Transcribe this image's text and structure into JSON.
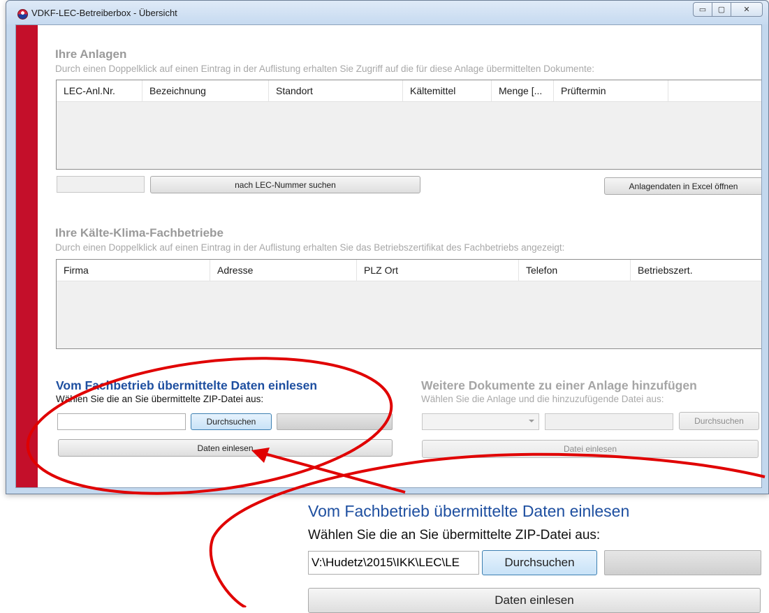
{
  "window": {
    "title": "VDKF-LEC-Betreiberbox - Übersicht",
    "controls": {
      "minimize": "▭",
      "maximize": "▢",
      "close": "✕"
    }
  },
  "anlagen": {
    "title": "Ihre Anlagen",
    "description": "Durch einen Doppelklick auf einen Eintrag in der Auflistung erhalten Sie Zugriff auf die für diese Anlage übermittelten Dokumente:",
    "columns": [
      "LEC-Anl.Nr.",
      "Bezeichnung",
      "Standort",
      "Kältemittel",
      "Menge [...",
      "Prüftermin"
    ],
    "search_value": "",
    "search_button": "nach LEC-Nummer suchen",
    "excel_button": "Anlagendaten in Excel öffnen"
  },
  "fachbetriebe": {
    "title": "Ihre Kälte-Klima-Fachbetriebe",
    "description": "Durch einen Doppelklick auf einen Eintrag in der Auflistung erhalten Sie das Betriebszertifikat des Fachbetriebs angezeigt:",
    "columns": [
      "Firma",
      "Adresse",
      "PLZ Ort",
      "Telefon",
      "Betriebszert."
    ]
  },
  "import": {
    "title": "Vom Fachbetrieb übermittelte Daten einlesen",
    "description": "Wählen Sie die an Sie übermittelte ZIP-Datei aus:",
    "file_value": "",
    "browse_button": "Durchsuchen",
    "read_button": "Daten einlesen"
  },
  "documents": {
    "title": "Weitere Dokumente zu einer Anlage hinzufügen",
    "description": "Wählen Sie die Anlage und die hinzuzufügende Datei aus:",
    "browse_button": "Durchsuchen",
    "read_button": "Datei einlesen"
  },
  "zoom": {
    "title": "Vom Fachbetrieb übermittelte Daten einlesen",
    "description": "Wählen Sie die an Sie übermittelte ZIP-Datei aus:",
    "file_value": "V:\\Hudetz\\2015\\IKK\\LEC\\LE",
    "browse_button": "Durchsuchen",
    "read_button": "Daten einlesen"
  },
  "colors": {
    "accent_red": "#c40f2a",
    "annotation_red": "#e00000",
    "title_blue": "#1e4fa0"
  }
}
